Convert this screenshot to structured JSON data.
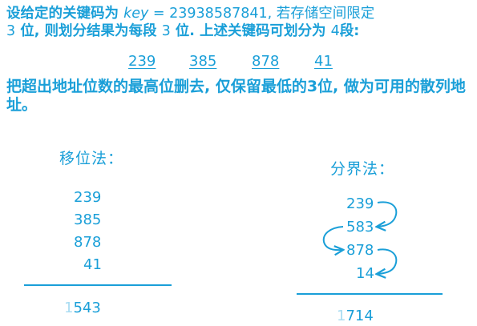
{
  "intro": {
    "part1": "设给定的关键码为 ",
    "key_word": "key",
    "part2": " = 23938587841, 若存储空间限定",
    "n1": "3",
    "part3": " 位, 则划分结果为每段 ",
    "n2": "3",
    "part4": " 位. 上述关键码可划分为 ",
    "n3": "4",
    "part5": "段:"
  },
  "segments": [
    "239",
    "385",
    "878",
    "41"
  ],
  "rule_text": "把超出地址位数的最高位删去, 仅保留最低的3位, 做为可用的散列地址。",
  "shift_method": {
    "heading": "移位法：",
    "values": [
      "239",
      "385",
      "878",
      "41"
    ],
    "sum_carry": "1",
    "sum_rest": "543"
  },
  "boundary_method": {
    "heading": "分界法：",
    "values": [
      "239",
      "583",
      "878",
      "14"
    ],
    "sum_carry": "1",
    "sum_rest": "714"
  },
  "colors": {
    "text": "#1a9fd8",
    "carry": "#a9dcf2"
  }
}
